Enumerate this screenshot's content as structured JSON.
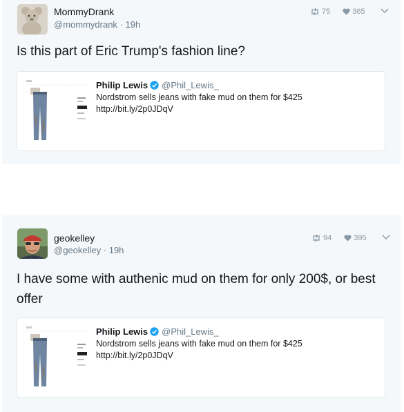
{
  "tweets": [
    {
      "name": "MommyDrank",
      "handle": "@mommydrank",
      "time": "19h",
      "retweets": "75",
      "likes": "365",
      "text": "Is this part of Eric Trump's fashion line?",
      "quote": {
        "name": "Philip Lewis",
        "handle": "@Phil_Lewis_",
        "text_line1": "Nordstrom sells jeans with fake mud on them for $425",
        "text_line2": "http://bit.ly/2p0JDqV"
      }
    },
    {
      "name": "geokelley",
      "handle": "@geokelley",
      "time": "19h",
      "retweets": "94",
      "likes": "395",
      "text": "I have some with authenic mud on them for only 200$, or best offer",
      "quote": {
        "name": "Philip Lewis",
        "handle": "@Phil_Lewis_",
        "text_line1": "Nordstrom sells jeans with fake mud on them for $425",
        "text_line2": "http://bit.ly/2p0JDqV"
      }
    }
  ],
  "separator": "·",
  "colors": {
    "card_background": "#f5f8fa",
    "verified_badge": "#1da1f2",
    "muted_text": "#657786",
    "action_icons": "#8899a6"
  },
  "icons": [
    "teddy-bear-avatar",
    "man-with-cap-avatar",
    "retweet-icon",
    "heart-icon",
    "chevron-down-icon",
    "verified-badge-icon",
    "jeans-thumbnail"
  ]
}
